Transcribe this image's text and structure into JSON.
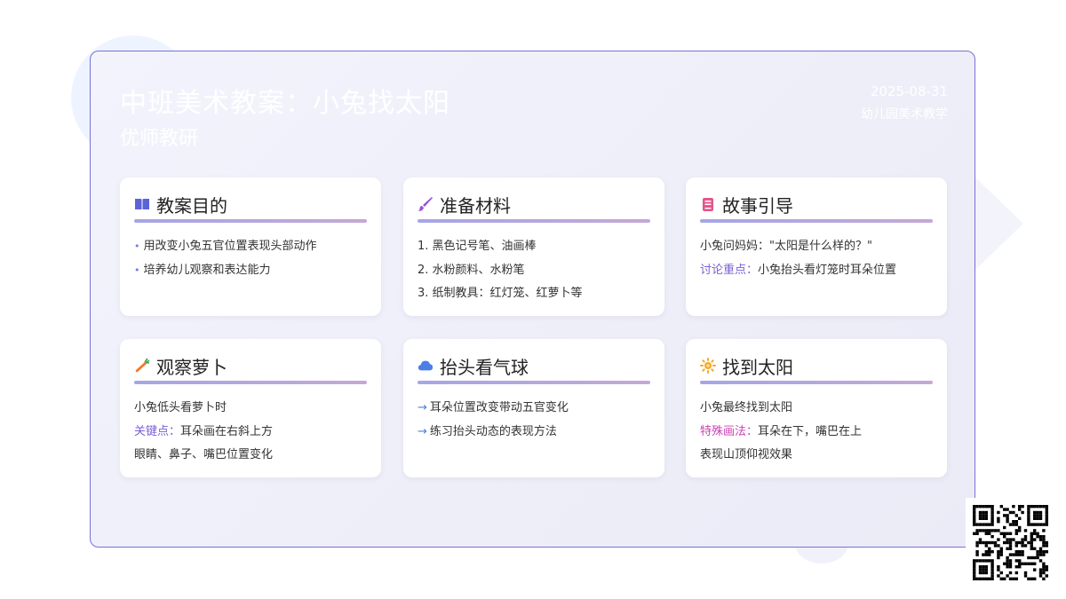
{
  "header": {
    "title": "中班美术教案：小兔找太阳",
    "subtitle": "优师教研",
    "date": "2025-08-31",
    "org": "幼儿园美术教学"
  },
  "cards": [
    {
      "icon": "book-icon",
      "title": "教案目的",
      "lines": [
        {
          "marker": "•",
          "text": "用改变小兔五官位置表现头部动作"
        },
        {
          "marker": "•",
          "text": "培养幼儿观察和表达能力"
        }
      ]
    },
    {
      "icon": "brush-icon",
      "title": "准备材料",
      "lines": [
        {
          "text": "1. 黑色记号笔、油画棒"
        },
        {
          "text": "2. 水粉颜料、水粉笔"
        },
        {
          "text": "3. 纸制教具：红灯笼、红萝卜等"
        }
      ]
    },
    {
      "icon": "story-book-icon",
      "title": "故事引导",
      "lines": [
        {
          "text": "小兔问妈妈：\"太阳是什么样的？\""
        },
        {
          "keyword": "讨论重点：",
          "text": "小兔抬头看灯笼时耳朵位置"
        }
      ]
    },
    {
      "icon": "carrot-icon",
      "title": "观察萝卜",
      "lines": [
        {
          "text": "小兔低头看萝卜时"
        },
        {
          "keyword": "关键点：",
          "text": "耳朵画在右斜上方"
        },
        {
          "text": "眼睛、鼻子、嘴巴位置变化"
        }
      ]
    },
    {
      "icon": "cloud-icon",
      "title": "抬头看气球",
      "lines": [
        {
          "marker": "→",
          "text": "耳朵位置改变带动五官变化"
        },
        {
          "marker": "→",
          "text": "练习抬头动态的表现方法"
        }
      ]
    },
    {
      "icon": "sun-icon",
      "title": "找到太阳",
      "lines": [
        {
          "text": "小兔最终找到太阳"
        },
        {
          "keyword": "特殊画法：",
          "text": "耳朵在下，嘴巴在上"
        },
        {
          "text": "表现山顶仰视效果"
        }
      ]
    }
  ],
  "colors": {
    "frame_border": "#7a6fd6",
    "book_icon": "#5b63d9",
    "brush_icon": "#9b4fd9",
    "story_book_icon": "#e5548a",
    "carrot_icon": "#f07a2c",
    "cloud_icon": "#4a7ee8",
    "sun_icon": "#f2a825",
    "keyword_purple": "#7b5fd6",
    "keyword_pink": "#cc3fb5"
  }
}
